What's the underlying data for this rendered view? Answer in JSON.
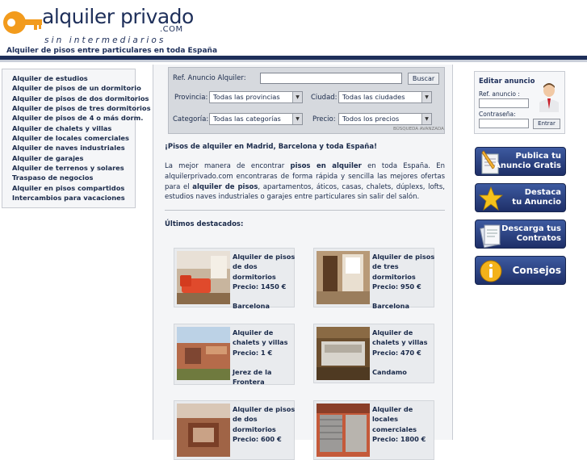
{
  "header": {
    "logo_title": "alquiler privado",
    "logo_com": ".COM",
    "logo_tagline": "sin intermediarios",
    "tagline": "Alquiler de pisos entre particulares en toda España"
  },
  "leftmenu": {
    "items": [
      "Alquiler de estudios",
      "Alquiler de pisos de un dormitorio",
      "Alquiler de pisos de dos dormitorios",
      "Alquiler de pisos de tres dormitorios",
      "Alquiler de pisos de 4 o más dorm.",
      "Alquiler de chalets y villas",
      "Alquiler de locales comerciales",
      "Alquiler de naves industriales",
      "Alquiler de garajes",
      "Alquiler de terrenos y solares",
      "Traspaso de negocios",
      "Alquiler en pisos compartidos",
      "Intercambios para vacaciones"
    ]
  },
  "search": {
    "ref_label": "Ref. Anuncio Alquiler:",
    "ref_value": "",
    "search_button": "Buscar",
    "provincia_label": "Provincia:",
    "provincia_value": "Todas las provincias",
    "ciudad_label": "Ciudad:",
    "ciudad_value": "Todas las ciudades",
    "categoria_label": "Categoría:",
    "categoria_value": "Todas las categorías",
    "precio_label": "Precio:",
    "precio_value": "Todos los precios",
    "advanced": "BÚSQUEDA AVANZADA"
  },
  "intro": {
    "title": "¡Pisos de alquiler en Madrid, Barcelona y toda España!",
    "p1": "La mejor manera de encontrar ",
    "b1": "pisos en alquiler",
    "p2": " en toda España. En alquilerprivado.com encontraras de forma rápida y sencilla las mejores ofertas para el ",
    "b2": "alquiler de pisos",
    "p3": ", apartamentos, áticos, casas, chalets, dúplexs, lofts, estudios naves industriales o garajes entre particulares sin salir del salón."
  },
  "featured": {
    "title": "Últimos destacados:",
    "cards": [
      {
        "lines": [
          "Alquiler de pisos",
          "de dos",
          "dormitorios",
          "Precio: 1450 €"
        ],
        "location": [
          "Barcelona"
        ]
      },
      {
        "lines": [
          "Alquiler de pisos",
          "de tres",
          "dormitorios",
          "Precio: 950 €"
        ],
        "location": [
          "Barcelona"
        ]
      },
      {
        "lines": [
          "Alquiler de",
          "chalets y villas",
          "Precio: 1 €"
        ],
        "location": [
          "Jerez de la",
          "Frontera"
        ]
      },
      {
        "lines": [
          "Alquiler de",
          "chalets y villas",
          "Precio: 470 €"
        ],
        "location": [
          "Candamo"
        ]
      },
      {
        "lines": [
          "Alquiler de pisos",
          "de dos",
          "dormitorios",
          "Precio: 600 €"
        ],
        "location": []
      },
      {
        "lines": [
          "Alquiler de",
          "locales",
          "comerciales",
          "Precio: 1800 €"
        ],
        "location": []
      }
    ]
  },
  "login": {
    "title": "Editar anuncio",
    "ref_label": "Ref. anuncio :",
    "pass_label": "Contraseña:",
    "button": "Entrar"
  },
  "actions": {
    "publica": [
      "Publica tu",
      "Anuncio Gratis"
    ],
    "destaca": [
      "Destaca",
      "tu Anuncio"
    ],
    "contratos": [
      "Descarga tus",
      "Contratos"
    ],
    "consejos": [
      "Consejos"
    ]
  },
  "colors": {
    "navy": "#1e2f5a",
    "logo_orange": "#f29b1d",
    "button_blue": "#2c4486"
  },
  "icons": [
    "key-icon",
    "person-icon",
    "pen-icon",
    "star-icon",
    "document-icon",
    "info-icon",
    "dropdown-arrow-icon"
  ]
}
